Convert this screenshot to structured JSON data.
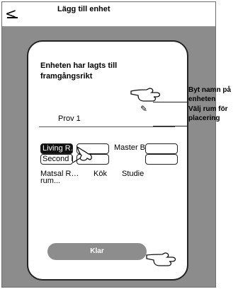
{
  "header": {
    "back_icon": "back-arrow-icon",
    "title": "Lägg till enhet"
  },
  "card": {
    "message": "Enheten har lagts till framgångsrikt",
    "device_name": "Prov 1",
    "rename_icon": "pencil-icon",
    "rooms_row1": [
      "Living R…",
      "",
      "Master Be…",
      ""
    ],
    "rooms_row2": [
      "Second B…",
      "",
      ""
    ],
    "rooms_text": [
      "Matsal R… rum...",
      "Kök",
      "Studie"
    ],
    "done_label": "Klar"
  },
  "callouts": {
    "rename": "Byt namn på enheten",
    "room": "Välj rum för placering"
  }
}
